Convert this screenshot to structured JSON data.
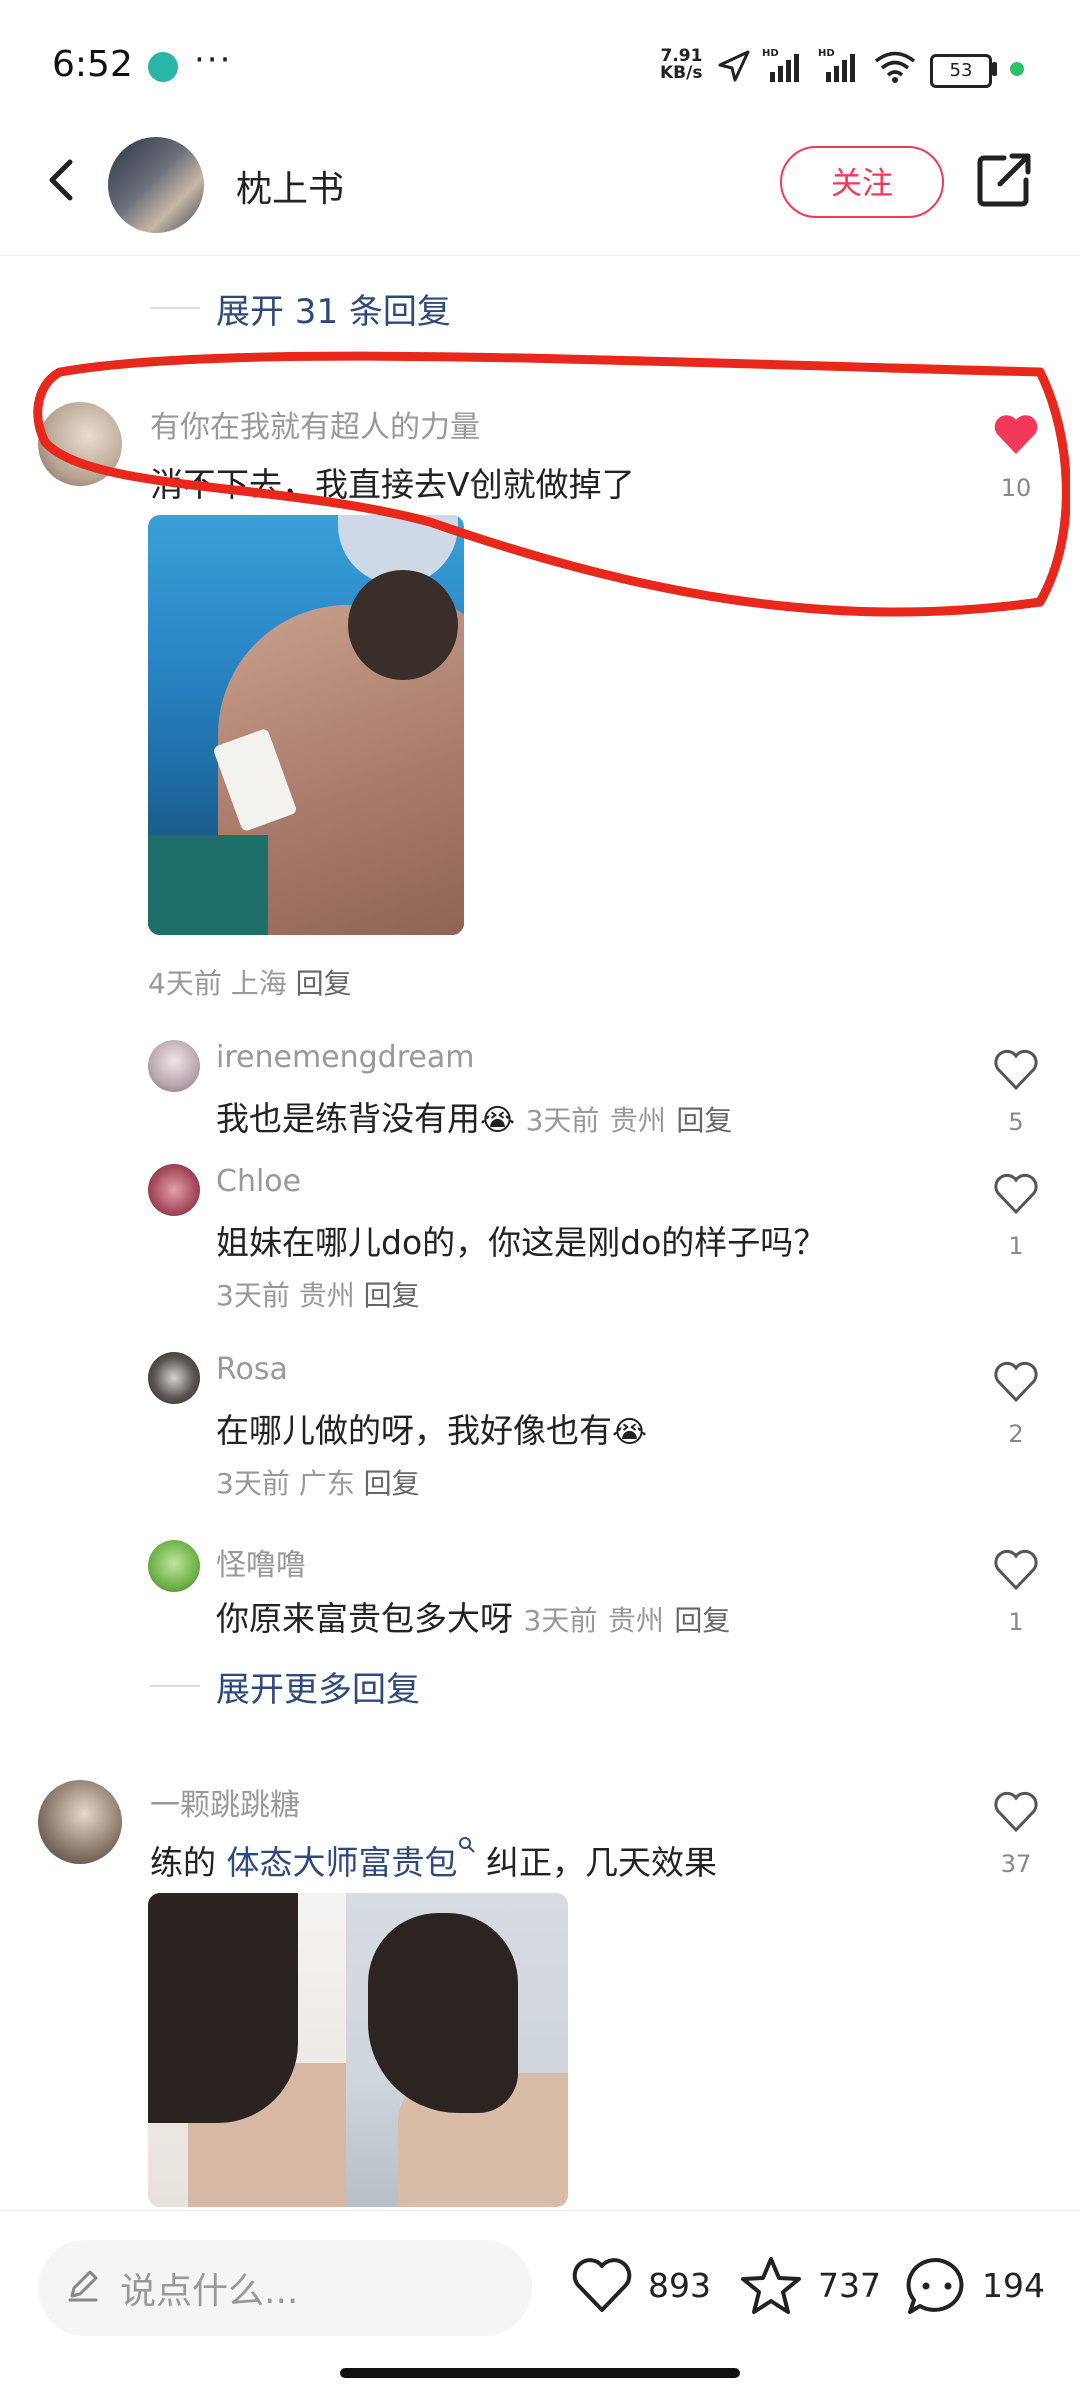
{
  "status_bar": {
    "time": "6:52",
    "dots": "···",
    "speed_top": "7.91",
    "speed_bottom": "KB/s",
    "battery": "53"
  },
  "header": {
    "author": "枕上书",
    "follow": "关注"
  },
  "expand_top": "展开 31 条回复",
  "comments": [
    {
      "user": "有你在我就有超人的力量",
      "text": "消不下去，我直接去V创就做掉了",
      "likes": "10",
      "meta_time": "4天前",
      "meta_loc": "上海",
      "reply": "回复",
      "replies": [
        {
          "user": "irenemengdream",
          "text": "我也是练背没有用",
          "emoji": "😭",
          "time": "3天前",
          "loc": "贵州",
          "reply": "回复",
          "likes": "5"
        },
        {
          "user": "Chloe",
          "text": "姐妹在哪儿do的，你这是刚do的样子吗？",
          "time": "3天前",
          "loc": "贵州",
          "reply": "回复",
          "likes": "1"
        },
        {
          "user": "Rosa",
          "text": "在哪儿做的呀，我好像也有",
          "emoji": "😭",
          "time": "3天前",
          "loc": "广东",
          "reply": "回复",
          "likes": "2"
        },
        {
          "user": "怪噜噜",
          "text": "你原来富贵包多大呀",
          "time": "3天前",
          "loc": "贵州",
          "reply": "回复",
          "likes": "1"
        }
      ],
      "expand_more": "展开更多回复"
    },
    {
      "user": "一颗跳跳糖",
      "text_prefix": "练的 ",
      "text_link": "体态大师富贵包",
      "text_suffix": " 纠正，几天效果",
      "likes": "37"
    }
  ],
  "bottom": {
    "placeholder": "说点什么...",
    "likes": "893",
    "stars": "737",
    "comments": "194"
  },
  "colors": {
    "accent": "#f2395b",
    "link": "#2f4a7a",
    "annotation": "#e8271d"
  },
  "icons": [
    "back-icon",
    "share-icon",
    "heart-icon",
    "heart-filled-icon",
    "star-icon",
    "comment-icon",
    "pencil-icon",
    "search-icon"
  ]
}
